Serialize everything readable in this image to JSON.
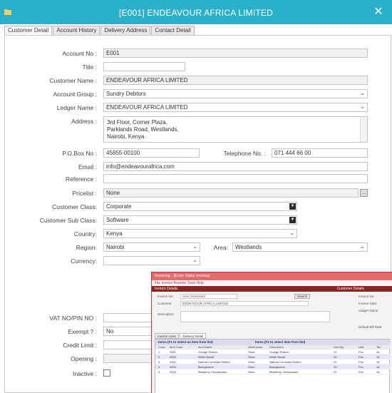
{
  "window": {
    "title": "[E001] ENDEAVOUR AFRICA LIMITED",
    "close_label": "✕",
    "accent_color": "#2ab0c8"
  },
  "tabs": [
    {
      "label": "Customer Detail",
      "active": true
    },
    {
      "label": "Account History",
      "active": false
    },
    {
      "label": "Delivery Address",
      "active": false
    },
    {
      "label": "Contact Detail",
      "active": false
    }
  ],
  "form": {
    "account_no": {
      "label": "Account No :",
      "value": "E001"
    },
    "title": {
      "label": "Title :",
      "value": ""
    },
    "customer_name": {
      "label": "Customer Name :",
      "value": "ENDEAVOUR AFRICA LIMITED"
    },
    "account_group": {
      "label": "Account Group :",
      "value": "Sundry Debtors"
    },
    "ledger_name": {
      "label": "Ledger Name :",
      "value": "ENDEAVOUR AFRICA LIMITED"
    },
    "address": {
      "label": "Address :",
      "lines": [
        "3rd Floor, Corner Plaza,",
        "Parklands Road, Westlands,",
        "Nairobi, Kenya"
      ]
    },
    "po_box": {
      "label": "P.O.Box No :",
      "value": "45855-00100"
    },
    "telephone": {
      "label": "Telephone No. :",
      "value": "071 444 66 00"
    },
    "email": {
      "label": "Email :",
      "value": "info@endeavourafrica.com"
    },
    "reference": {
      "label": "Reference :",
      "value": ""
    },
    "pricelist": {
      "label": "Pricelist :",
      "value": "None"
    },
    "customer_class": {
      "label": "Customer Class:",
      "value": "Corporate"
    },
    "customer_sub_class": {
      "label": "Customer Sub Class:",
      "value": "Software"
    },
    "country": {
      "label": "Country:",
      "value": "Kenya"
    },
    "region": {
      "label": "Region:",
      "value": "Nairobi"
    },
    "area": {
      "label": "Area:",
      "value": "Westlands"
    },
    "currency": {
      "label": "Currency:",
      "value": ""
    },
    "vat_no": {
      "label": "VAT NO/PIN NO :",
      "value": ""
    },
    "exempt": {
      "label": "Exempt ? :",
      "value": "No"
    },
    "credit_limit": {
      "label": "Credit Limit :",
      "value": ""
    },
    "opening": {
      "label": "Opening :",
      "value": ""
    },
    "inactive": {
      "label": "Inactive :",
      "checked": false
    }
  },
  "overlay": {
    "title": "Invoicing - [Enter Sales Invoice]",
    "menu": "File   Invoice   Reports   Tools   Help",
    "bar_left": "Invoice Details",
    "bar_right": "Customer Details",
    "fields": {
      "invoice_no_label": "Invoice No:",
      "invoice_no_value": "Auto Generated",
      "customer_label": "Customer:",
      "customer_value": "ENDEAVOUR AFRICA LIMITED",
      "description_label": "Description:",
      "search_button": "Search",
      "right_labels": [
        "Invoice No:",
        "Invoice Date:",
        "Ledger Name:",
        "Default Bill Rate:"
      ]
    },
    "tabs": [
      "Invoice Lines",
      "Delivery Detail"
    ],
    "grid_heads": [
      "Items (F1 to select an item from list)",
      "Items (F2 to select item from list)"
    ],
    "col_heads": [
      "Code",
      "Item Code",
      "Item Name",
      "Warehouse",
      "Description",
      "Unit Qty",
      "Unit",
      "Tax"
    ],
    "rows": [
      [
        "1",
        "0001",
        "Orange Rollers",
        "Store",
        "Orange Rollers",
        "20",
        "Pcs",
        "16"
      ],
      [
        "2",
        "0002",
        "White Bread",
        "Store",
        "White Bread",
        "20",
        "Pcs",
        "16"
      ],
      [
        "3",
        "0003",
        "Natural Cornelian Rollers",
        "Store",
        "Natural Cornelian Rollers",
        "20",
        "Pcs",
        "16"
      ],
      [
        "4",
        "0004",
        "Bourgeonne",
        "Store",
        "Bourgeonne",
        "20",
        "Pcs",
        "16"
      ],
      [
        "5",
        "0005",
        "Blueberry Cheesecake",
        "Store",
        "Blueberry Cheesecake",
        "20",
        "Pcs",
        "16"
      ]
    ]
  }
}
